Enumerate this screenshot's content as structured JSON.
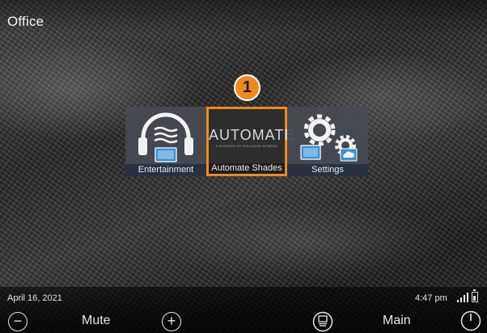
{
  "header": {
    "room_title": "Office"
  },
  "tiles": [
    {
      "label": "Entertainment",
      "icon": "headphones-monitor-icon"
    },
    {
      "label": "Automate Shades",
      "icon": "automate-logo",
      "logo_text": "AUTOMATE",
      "logo_subtext": "A DIVISION OF ROLLEASE ACMEDA",
      "highlighted": true
    },
    {
      "label": "Settings",
      "icon": "gears-cloud-icon"
    }
  ],
  "callout": {
    "number": "1",
    "color": "#f08a1a"
  },
  "status": {
    "date": "April 16, 2021",
    "time": "4:47 pm"
  },
  "footer": {
    "minus_icon": "minus-circle-icon",
    "mute_label": "Mute",
    "plus_icon": "plus-circle-icon",
    "remote_icon": "remote-icon",
    "main_label": "Main",
    "power_icon": "power-icon"
  },
  "colors": {
    "accent": "#f08a1a",
    "tile_label_bg": "#283040"
  }
}
